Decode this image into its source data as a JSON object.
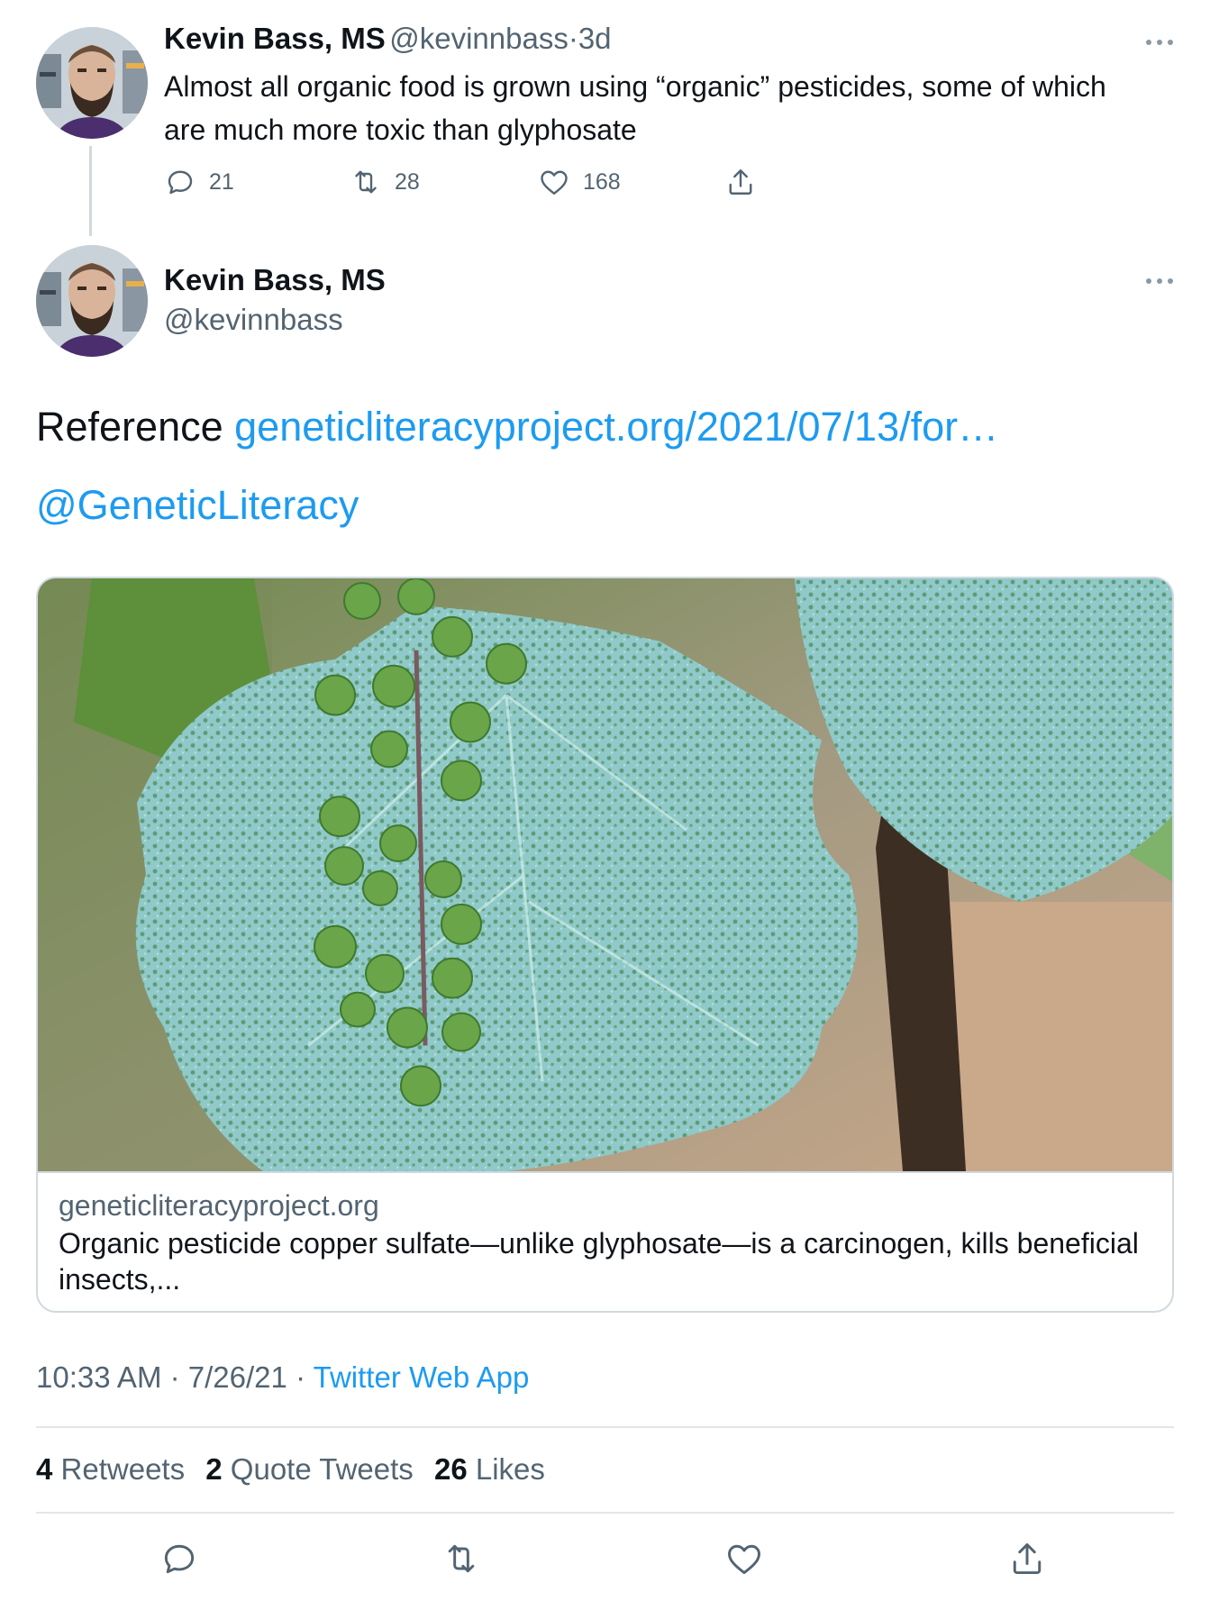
{
  "thread_tweet": {
    "author_name": "Kevin Bass, MS",
    "handle": "@kevinnbass",
    "separator": "·",
    "age": "3d",
    "text": "Almost all organic food is grown using “organic” pesticides, some of which are much more toxic than glyphosate",
    "replies": "21",
    "retweets": "28",
    "likes": "168"
  },
  "main_tweet": {
    "author_name": "Kevin Bass, MS",
    "handle": "@kevinnbass",
    "text_prefix": "Reference",
    "link_text": "geneticliteracyproject.org/2021/07/13/for…",
    "mention": "@GeneticLiteracy",
    "card": {
      "domain": "geneticliteracyproject.org",
      "title": "Organic pesticide copper sulfate—unlike glyphosate—is a carcinogen, kills beneficial insects,..."
    },
    "time": "10:33 AM",
    "date": "7/26/21",
    "source": "Twitter Web App",
    "stats": {
      "retweets_count": "4",
      "retweets_label": "Retweets",
      "quotes_count": "2",
      "quotes_label": "Quote Tweets",
      "likes_count": "26",
      "likes_label": "Likes"
    }
  },
  "colors": {
    "accent": "#1d9bf0",
    "secondary_text": "#536471",
    "border": "#cfd9de"
  },
  "icons": {
    "reply": "reply-icon",
    "retweet": "retweet-icon",
    "like": "heart-icon",
    "share": "share-icon",
    "more": "more-icon"
  }
}
